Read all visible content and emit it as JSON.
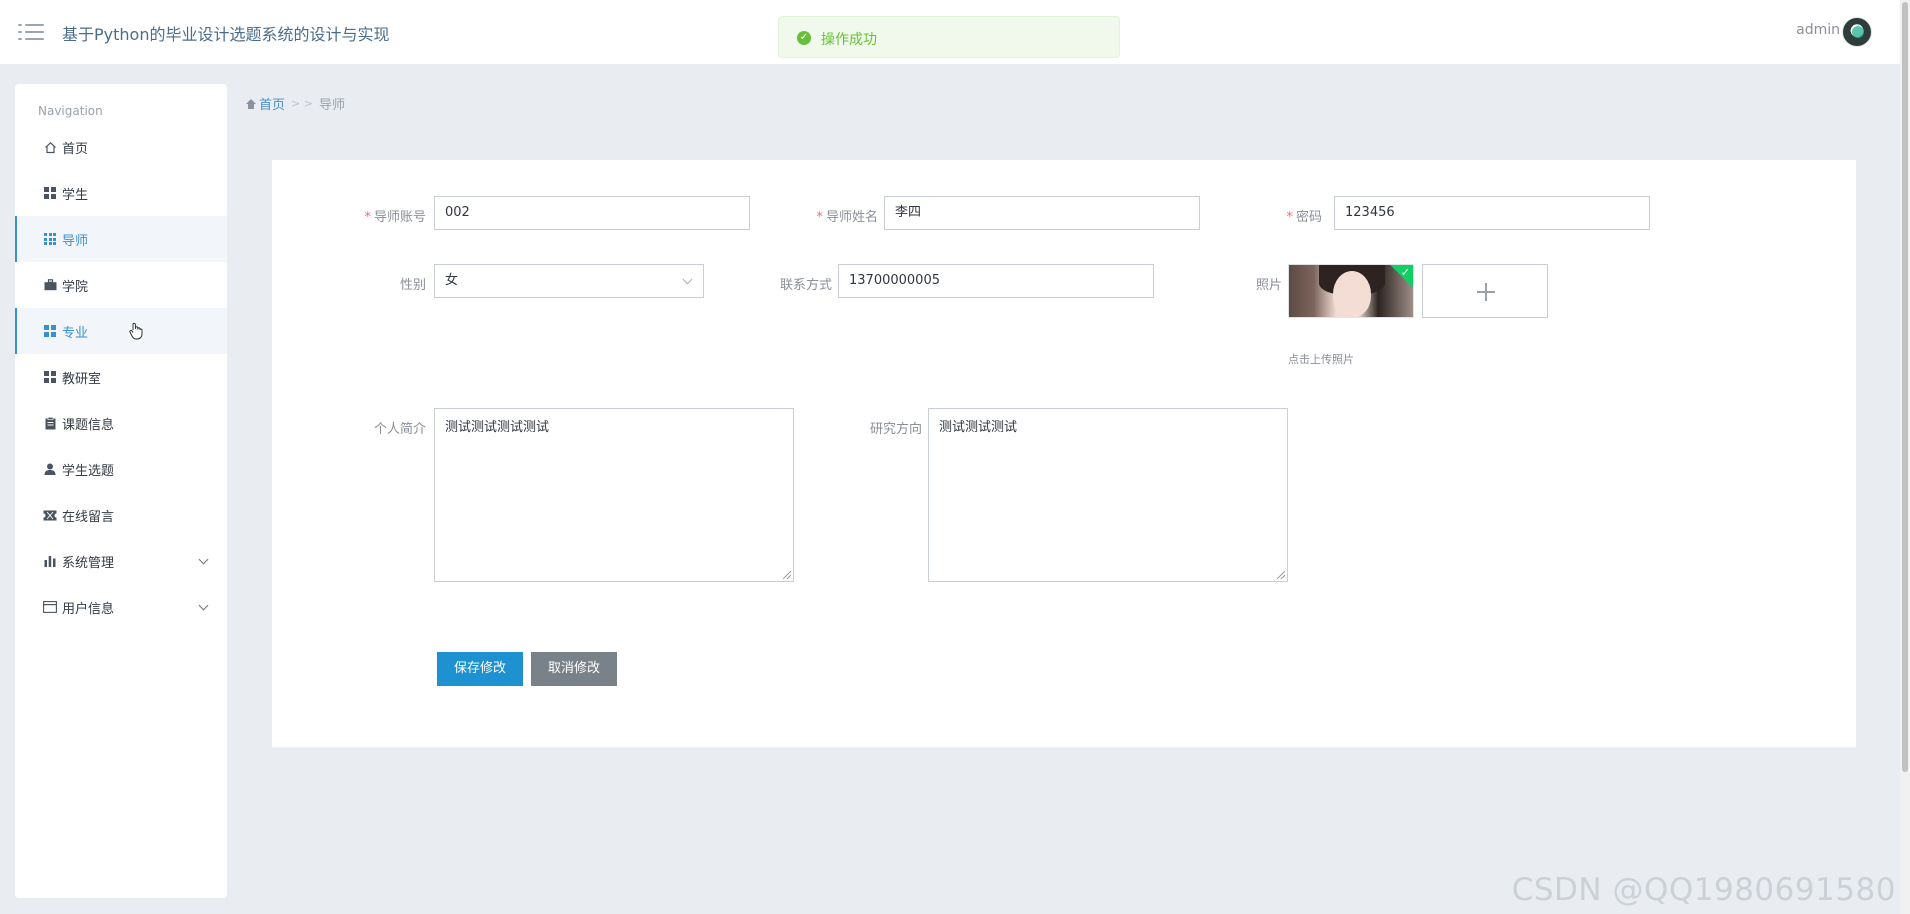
{
  "header": {
    "title": "基于Python的毕业设计选题系统的设计与实现",
    "user": "admin"
  },
  "toast": {
    "message": "操作成功",
    "color": "#67c23a"
  },
  "sidebar": {
    "heading": "Navigation",
    "items": [
      {
        "label": "首页",
        "icon": "home-icon",
        "state": "normal"
      },
      {
        "label": "学生",
        "icon": "grid-icon",
        "state": "normal"
      },
      {
        "label": "导师",
        "icon": "grid9-icon",
        "state": "active"
      },
      {
        "label": "学院",
        "icon": "briefcase-icon",
        "state": "normal"
      },
      {
        "label": "专业",
        "icon": "grid-icon",
        "state": "hover"
      },
      {
        "label": "教研室",
        "icon": "grid-icon",
        "state": "normal"
      },
      {
        "label": "课题信息",
        "icon": "clipboard-icon",
        "state": "normal"
      },
      {
        "label": "学生选题",
        "icon": "user-icon",
        "state": "normal"
      },
      {
        "label": "在线留言",
        "icon": "ticket-icon",
        "state": "normal"
      },
      {
        "label": "系统管理",
        "icon": "bar-chart-icon",
        "state": "normal",
        "expandable": true
      },
      {
        "label": "用户信息",
        "icon": "card-icon",
        "state": "normal",
        "expandable": true
      }
    ],
    "accent_color": "#3a8fd0"
  },
  "breadcrumb": {
    "home": "首页",
    "separator": "> >",
    "current": "导师"
  },
  "form": {
    "account": {
      "label": "导师账号",
      "value": "002",
      "required": true
    },
    "name": {
      "label": "导师姓名",
      "value": "李四",
      "required": true
    },
    "password": {
      "label": "密码",
      "value": "123456",
      "required": true
    },
    "gender": {
      "label": "性别",
      "value": "女"
    },
    "contact": {
      "label": "联系方式",
      "value": "13700000005"
    },
    "photo": {
      "label": "照片",
      "tip": "点击上传照片"
    },
    "bio": {
      "label": "个人简介",
      "value": "测试测试测试测试"
    },
    "research": {
      "label": "研究方向",
      "value": "测试测试测试"
    },
    "save_label": "保存修改",
    "cancel_label": "取消修改"
  },
  "watermark": "CSDN @QQ1980691580"
}
